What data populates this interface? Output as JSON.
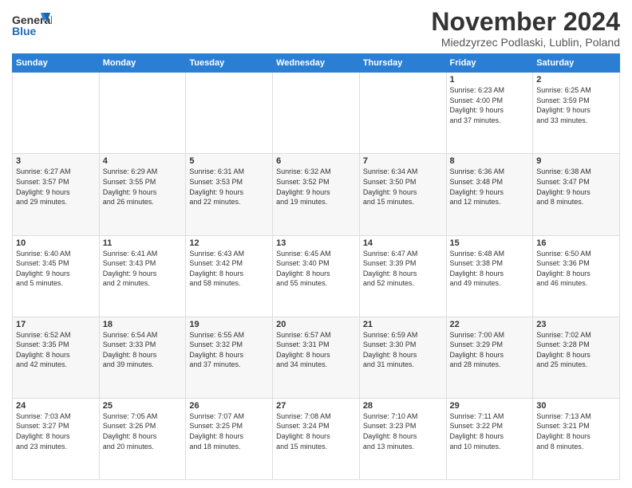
{
  "header": {
    "logo_line1": "General",
    "logo_line2": "Blue",
    "month_title": "November 2024",
    "location": "Miedzyrzec Podlaski, Lublin, Poland"
  },
  "weekdays": [
    "Sunday",
    "Monday",
    "Tuesday",
    "Wednesday",
    "Thursday",
    "Friday",
    "Saturday"
  ],
  "weeks": [
    [
      {
        "day": "",
        "info": ""
      },
      {
        "day": "",
        "info": ""
      },
      {
        "day": "",
        "info": ""
      },
      {
        "day": "",
        "info": ""
      },
      {
        "day": "",
        "info": ""
      },
      {
        "day": "1",
        "info": "Sunrise: 6:23 AM\nSunset: 4:00 PM\nDaylight: 9 hours\nand 37 minutes."
      },
      {
        "day": "2",
        "info": "Sunrise: 6:25 AM\nSunset: 3:59 PM\nDaylight: 9 hours\nand 33 minutes."
      }
    ],
    [
      {
        "day": "3",
        "info": "Sunrise: 6:27 AM\nSunset: 3:57 PM\nDaylight: 9 hours\nand 29 minutes."
      },
      {
        "day": "4",
        "info": "Sunrise: 6:29 AM\nSunset: 3:55 PM\nDaylight: 9 hours\nand 26 minutes."
      },
      {
        "day": "5",
        "info": "Sunrise: 6:31 AM\nSunset: 3:53 PM\nDaylight: 9 hours\nand 22 minutes."
      },
      {
        "day": "6",
        "info": "Sunrise: 6:32 AM\nSunset: 3:52 PM\nDaylight: 9 hours\nand 19 minutes."
      },
      {
        "day": "7",
        "info": "Sunrise: 6:34 AM\nSunset: 3:50 PM\nDaylight: 9 hours\nand 15 minutes."
      },
      {
        "day": "8",
        "info": "Sunrise: 6:36 AM\nSunset: 3:48 PM\nDaylight: 9 hours\nand 12 minutes."
      },
      {
        "day": "9",
        "info": "Sunrise: 6:38 AM\nSunset: 3:47 PM\nDaylight: 9 hours\nand 8 minutes."
      }
    ],
    [
      {
        "day": "10",
        "info": "Sunrise: 6:40 AM\nSunset: 3:45 PM\nDaylight: 9 hours\nand 5 minutes."
      },
      {
        "day": "11",
        "info": "Sunrise: 6:41 AM\nSunset: 3:43 PM\nDaylight: 9 hours\nand 2 minutes."
      },
      {
        "day": "12",
        "info": "Sunrise: 6:43 AM\nSunset: 3:42 PM\nDaylight: 8 hours\nand 58 minutes."
      },
      {
        "day": "13",
        "info": "Sunrise: 6:45 AM\nSunset: 3:40 PM\nDaylight: 8 hours\nand 55 minutes."
      },
      {
        "day": "14",
        "info": "Sunrise: 6:47 AM\nSunset: 3:39 PM\nDaylight: 8 hours\nand 52 minutes."
      },
      {
        "day": "15",
        "info": "Sunrise: 6:48 AM\nSunset: 3:38 PM\nDaylight: 8 hours\nand 49 minutes."
      },
      {
        "day": "16",
        "info": "Sunrise: 6:50 AM\nSunset: 3:36 PM\nDaylight: 8 hours\nand 46 minutes."
      }
    ],
    [
      {
        "day": "17",
        "info": "Sunrise: 6:52 AM\nSunset: 3:35 PM\nDaylight: 8 hours\nand 42 minutes."
      },
      {
        "day": "18",
        "info": "Sunrise: 6:54 AM\nSunset: 3:33 PM\nDaylight: 8 hours\nand 39 minutes."
      },
      {
        "day": "19",
        "info": "Sunrise: 6:55 AM\nSunset: 3:32 PM\nDaylight: 8 hours\nand 37 minutes."
      },
      {
        "day": "20",
        "info": "Sunrise: 6:57 AM\nSunset: 3:31 PM\nDaylight: 8 hours\nand 34 minutes."
      },
      {
        "day": "21",
        "info": "Sunrise: 6:59 AM\nSunset: 3:30 PM\nDaylight: 8 hours\nand 31 minutes."
      },
      {
        "day": "22",
        "info": "Sunrise: 7:00 AM\nSunset: 3:29 PM\nDaylight: 8 hours\nand 28 minutes."
      },
      {
        "day": "23",
        "info": "Sunrise: 7:02 AM\nSunset: 3:28 PM\nDaylight: 8 hours\nand 25 minutes."
      }
    ],
    [
      {
        "day": "24",
        "info": "Sunrise: 7:03 AM\nSunset: 3:27 PM\nDaylight: 8 hours\nand 23 minutes."
      },
      {
        "day": "25",
        "info": "Sunrise: 7:05 AM\nSunset: 3:26 PM\nDaylight: 8 hours\nand 20 minutes."
      },
      {
        "day": "26",
        "info": "Sunrise: 7:07 AM\nSunset: 3:25 PM\nDaylight: 8 hours\nand 18 minutes."
      },
      {
        "day": "27",
        "info": "Sunrise: 7:08 AM\nSunset: 3:24 PM\nDaylight: 8 hours\nand 15 minutes."
      },
      {
        "day": "28",
        "info": "Sunrise: 7:10 AM\nSunset: 3:23 PM\nDaylight: 8 hours\nand 13 minutes."
      },
      {
        "day": "29",
        "info": "Sunrise: 7:11 AM\nSunset: 3:22 PM\nDaylight: 8 hours\nand 10 minutes."
      },
      {
        "day": "30",
        "info": "Sunrise: 7:13 AM\nSunset: 3:21 PM\nDaylight: 8 hours\nand 8 minutes."
      }
    ]
  ]
}
